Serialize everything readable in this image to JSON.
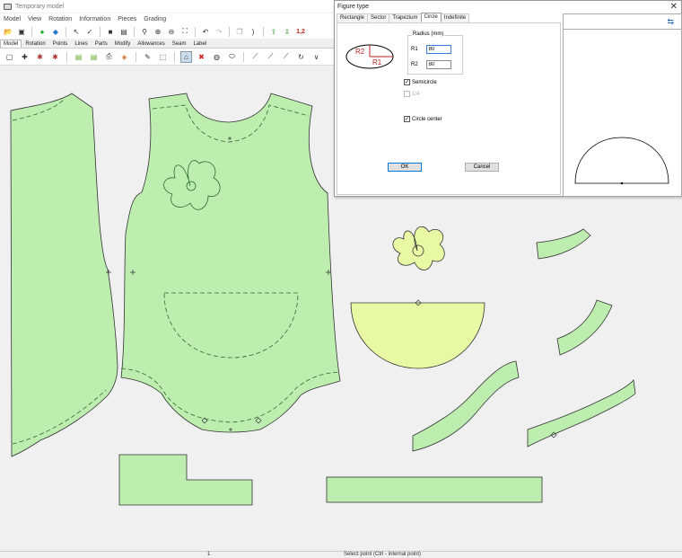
{
  "window": {
    "title": "Temporary model"
  },
  "menu": [
    "Model",
    "View",
    "Rotation",
    "Information",
    "Pieces",
    "Grading"
  ],
  "toolbar1": [
    "open-icon",
    "save-icon",
    "sep",
    "select-icon",
    "brush-icon",
    "sep",
    "pointer-icon",
    "check-icon",
    "sep",
    "block-icon",
    "layers-icon",
    "sep",
    "zoom-icon",
    "zoom-in-icon",
    "zoom-out-icon",
    "fit-icon",
    "sep",
    "undo-icon",
    "redo-icon",
    "sep",
    "copy-icon",
    "paren-icon",
    "sep",
    "export-icon",
    "export2-icon",
    "grade-icon"
  ],
  "toolbar1_label_12": "1,2",
  "tabs": [
    "Model",
    "Rotation",
    "Points",
    "Lines",
    "Parts",
    "Modify",
    "Allowances",
    "Seam",
    "Label"
  ],
  "active_tab": "Model",
  "toolbar2_count": 22,
  "status": {
    "count": "1",
    "hint": "Select point (Ctrl - internal point)"
  },
  "dialog": {
    "title": "Figure type",
    "close": "✕",
    "tabs": [
      "Rectangle",
      "Sector",
      "Trapezium",
      "Circle",
      "Indefinite"
    ],
    "active_tab": "Circle",
    "radius_group_label": "Radius (mm)",
    "r1_label": "R1",
    "r1_value": "80",
    "r2_label": "R2",
    "r2_value": "80",
    "preview_label_r1": "R1",
    "preview_label_r2": "R2",
    "semicircle_label": "Semicircle",
    "semicircle_checked": "✓",
    "quarter_label": "1/4",
    "circle_center_label": "Circle center",
    "circle_center_checked": "✓",
    "ok_label": "OK",
    "cancel_label": "Cancel",
    "refresh_icon": "⇆"
  },
  "colors": {
    "piece_fill": "#bdeeb0",
    "piece_stroke": "#333333",
    "semicircle_fill": "#e7f9a4",
    "seam_stroke": "#2d6b2d",
    "canvas_bg": "#f0f0f0"
  }
}
